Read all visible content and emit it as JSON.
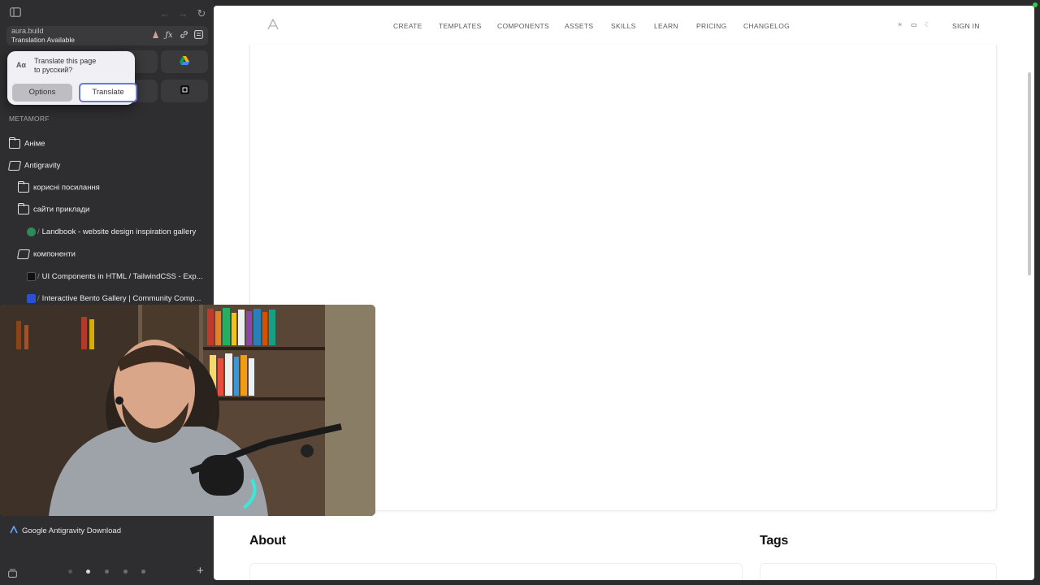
{
  "browser": {
    "address": {
      "url": "aura.build",
      "status": "Translation Available"
    },
    "translate_popup": {
      "icon_label": "Aα",
      "message_line1": "Translate this page",
      "message_line2": "to русский?",
      "options_label": "Options",
      "translate_label": "Translate"
    }
  },
  "sidebar": {
    "section_label": "METAMORF",
    "items": [
      {
        "label": "Аніме"
      },
      {
        "label": "Antigravity"
      },
      {
        "label": "корисні посилання"
      },
      {
        "label": "сайти приклади"
      },
      {
        "label": "Landbook - website design inspiration gallery"
      },
      {
        "label": "компоненти"
      },
      {
        "label": "UI Components in HTML / TailwindCSS - Exp..."
      },
      {
        "label": "Interactive Bento Gallery | Community Comp..."
      }
    ],
    "bottom_link": "Google Antigravity Download"
  },
  "site": {
    "nav": [
      "CREATE",
      "TEMPLATES",
      "COMPONENTS",
      "ASSETS",
      "SKILLS",
      "LEARN",
      "PRICING",
      "CHANGELOG"
    ],
    "sign_in": "SIGN IN",
    "about_title": "About",
    "tags_title": "Tags"
  },
  "colors": {
    "sidebar_bg": "#2e2e30",
    "popup_accent": "#6e7ad8",
    "page_bg": "#ffffff"
  }
}
